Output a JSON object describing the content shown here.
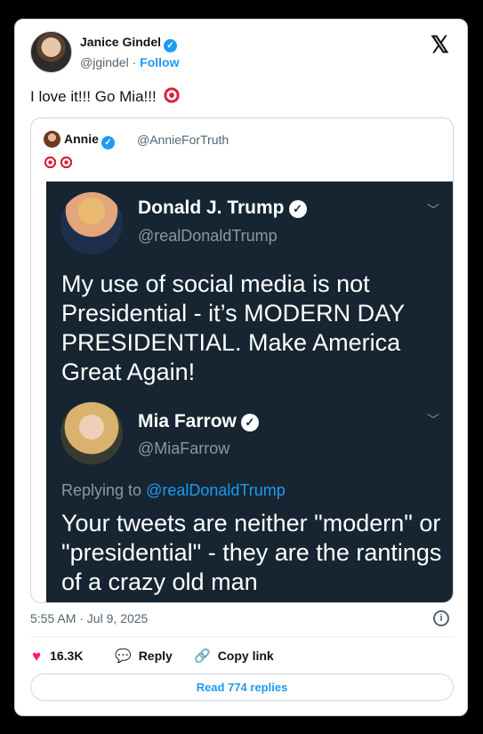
{
  "author": {
    "name": "Janice Gindel",
    "handle": "@jgindel",
    "separator": "·",
    "follow_label": "Follow"
  },
  "tweet": {
    "text": "I love it!!!  Go Mia!!!",
    "emoji": "direct-hit-emoji"
  },
  "quote": {
    "name": "Annie",
    "handle": "@AnnieForTruth",
    "emoji": [
      "direct-hit-emoji",
      "direct-hit-emoji"
    ]
  },
  "embedded_screenshot": {
    "first_post": {
      "name": "Donald J. Trump",
      "handle": "@realDonaldTrump",
      "text": "My use of social media is not Presidential - it’s MODERN DAY PRESIDENTIAL. Make America Great Again!"
    },
    "second_post": {
      "name": "Mia Farrow",
      "handle": "@MiaFarrow",
      "replying_prefix": "Replying to",
      "replying_to": "@realDonaldTrump",
      "text": "Your tweets are neither \"modern\" or \"presidential\" - they are the rantings of a crazy old man"
    }
  },
  "footer": {
    "timestamp": "5:55 AM · Jul 9, 2025",
    "likes": "16.3K",
    "reply_label": "Reply",
    "copy_link_label": "Copy link",
    "read_replies_label": "Read 774 replies"
  },
  "icons": {
    "x_logo": "x-logo-icon",
    "verified": "verified-badge-icon",
    "info": "info-icon",
    "heart": "heart-icon",
    "reply": "reply-bubble-icon",
    "link": "link-icon",
    "chevron": "chevron-down-icon"
  },
  "colors": {
    "accent": "#1d9bf0",
    "like": "#f91880",
    "embed_background": "#162531"
  }
}
